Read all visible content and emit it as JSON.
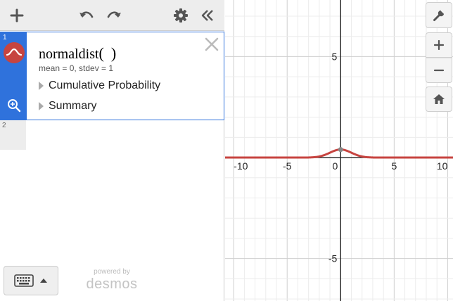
{
  "expressions": [
    {
      "index": "1",
      "formula_name": "normaldist",
      "formula_open": "(",
      "formula_close": ")",
      "params": "mean = 0,  stdev = 1",
      "cumulative_label": "Cumulative Probability",
      "summary_label": "Summary",
      "color": "#c74440"
    },
    {
      "index": "2"
    }
  ],
  "branding": {
    "powered_by": "powered by",
    "logo_text": "desmos"
  },
  "graph": {
    "x_range": [
      -10.8,
      10.5
    ],
    "y_range": [
      -7.1,
      7.8
    ],
    "x_tick_labels": [
      "-10",
      "-5",
      "0",
      "5",
      "10"
    ],
    "y_tick_labels": [
      "5",
      "-5"
    ],
    "curve": {
      "type": "normal",
      "mean": 0,
      "stdev": 1,
      "color": "#c74440"
    },
    "peak_point": {
      "x": 0,
      "y": 0.3989
    }
  },
  "icons": {
    "add": "plus-icon",
    "undo": "undo-icon",
    "redo": "redo-icon",
    "settings": "gear-icon",
    "collapse": "double-chevron-left-icon",
    "wrench": "wrench-icon",
    "zoom_in": "plus-icon",
    "zoom_out": "minus-icon",
    "home": "home-icon",
    "keyboard": "keyboard-icon"
  }
}
